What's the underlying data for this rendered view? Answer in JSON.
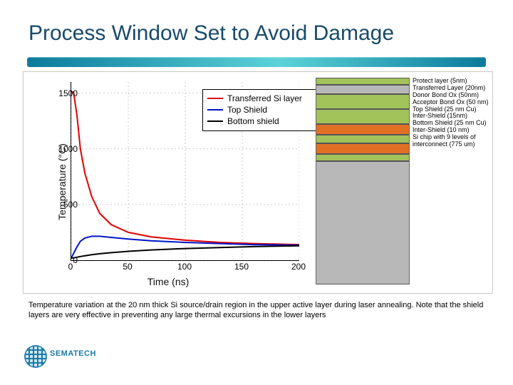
{
  "title": "Process Window Set to Avoid Damage",
  "caption": "Temperature variation at the 20 nm thick Si source/drain region in the upper active layer during laser annealing. Note that the shield layers are very effective in preventing any large thermal excursions in the lower layers",
  "footer": {
    "brand": "SEMATECH"
  },
  "chart_data": {
    "type": "line",
    "xlabel": "Time (ns)",
    "ylabel": "Temperature (°C)",
    "xlim": [
      0,
      200
    ],
    "ylim": [
      0,
      1600
    ],
    "xticks": [
      0,
      50,
      100,
      150,
      200
    ],
    "yticks": [
      0,
      500,
      1000,
      1500
    ],
    "legend": {
      "position": "upper-right",
      "items": [
        {
          "name": "Transferred Si layer",
          "color": "#e00000"
        },
        {
          "name": "Top Shield",
          "color": "#0015c9"
        },
        {
          "name": "Bottom shield",
          "color": "#000000"
        }
      ]
    },
    "x": [
      0,
      2,
      5,
      8,
      12,
      18,
      25,
      35,
      50,
      70,
      100,
      130,
      160,
      200
    ],
    "series": [
      {
        "name": "Transferred Si layer",
        "color": "#e00000",
        "values": [
          1510,
          1510,
          1300,
          1000,
          780,
          570,
          420,
          320,
          250,
          210,
          180,
          160,
          150,
          140
        ]
      },
      {
        "name": "Top Shield",
        "color": "#0015c9",
        "values": [
          20,
          60,
          120,
          170,
          200,
          215,
          215,
          205,
          190,
          175,
          160,
          150,
          140,
          135
        ]
      },
      {
        "name": "Bottom shield",
        "color": "#000000",
        "values": [
          20,
          22,
          27,
          33,
          40,
          50,
          58,
          68,
          80,
          92,
          105,
          114,
          122,
          130
        ]
      }
    ]
  },
  "stack": {
    "layers": [
      {
        "label": "Protect layer (5nm)",
        "color": "#a2c25a",
        "h": 8
      },
      {
        "label": "Transferred Layer (20nm)",
        "color": "#b8b8b8",
        "h": 12
      },
      {
        "label": "Donor Bond Ox (50nm)",
        "color": "#a2c25a",
        "h": 20
      },
      {
        "label": "Acceptor Bond Ox (50 nm)",
        "color": "#a2c25a",
        "h": 20
      },
      {
        "label": "Top Shield (25 nm Cu)",
        "color": "#e07124",
        "h": 14
      },
      {
        "label": "Inter-Shield (15nm)",
        "color": "#a2c25a",
        "h": 10
      },
      {
        "label": "Bottom Shield (25 nm Cu)",
        "color": "#e07124",
        "h": 14
      },
      {
        "label": "Inter-Shield (10 nm)",
        "color": "#a2c25a",
        "h": 8
      },
      {
        "label": "Si chip with 9 levels of interconnect (775 um)",
        "color": "#b8b8b8",
        "h": 180
      }
    ]
  }
}
